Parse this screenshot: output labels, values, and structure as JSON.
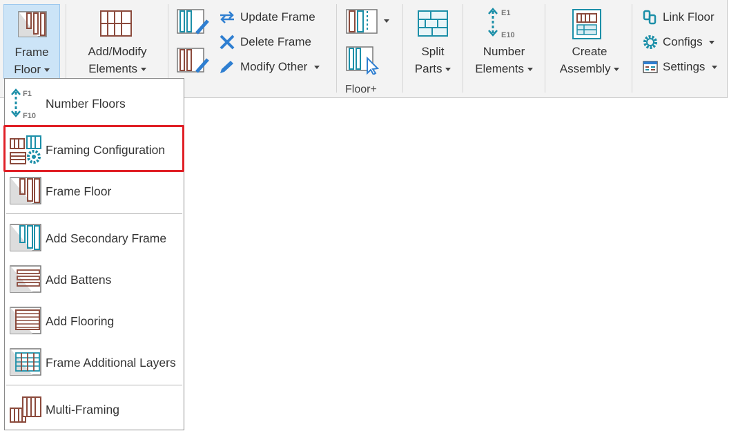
{
  "ribbon": {
    "frame_floor": {
      "line1": "Frame",
      "line2": "Floor"
    },
    "add_modify": {
      "line1": "Add/Modify",
      "line2": "Elements"
    },
    "update_frame": "Update Frame",
    "delete_frame": "Delete Frame",
    "modify_other": "Modify Other",
    "split_parts": {
      "line1": "Split",
      "line2": "Parts"
    },
    "number_elements": {
      "line1": "Number",
      "line2": "Elements",
      "icon_top": "E1",
      "icon_bottom": "E10"
    },
    "create_assembly": {
      "line1": "Create",
      "line2": "Assembly"
    },
    "link_floor": "Link Floor",
    "configs": "Configs",
    "settings": "Settings",
    "group_label": "Floor+"
  },
  "menu": {
    "items": [
      {
        "label": "Number Floors",
        "icon": "number-floors-icon",
        "icon_top": "F1",
        "icon_bottom": "F10"
      },
      {
        "label": "Framing Configuration",
        "icon": "framing-configuration-icon",
        "highlighted": true
      },
      {
        "label": "Frame Floor",
        "icon": "frame-floor-icon"
      },
      {
        "label": "Add Secondary Frame",
        "icon": "secondary-frame-icon"
      },
      {
        "label": "Add Battens",
        "icon": "battens-icon"
      },
      {
        "label": "Add Flooring",
        "icon": "flooring-icon"
      },
      {
        "label": "Frame Additional Layers",
        "icon": "additional-layers-icon"
      },
      {
        "label": "Multi-Framing",
        "icon": "multi-framing-icon"
      }
    ]
  },
  "colors": {
    "brown": "#8b4a3c",
    "teal": "#1c8fa8",
    "blue": "#2f7fd1",
    "highlight": "#e01f26"
  }
}
